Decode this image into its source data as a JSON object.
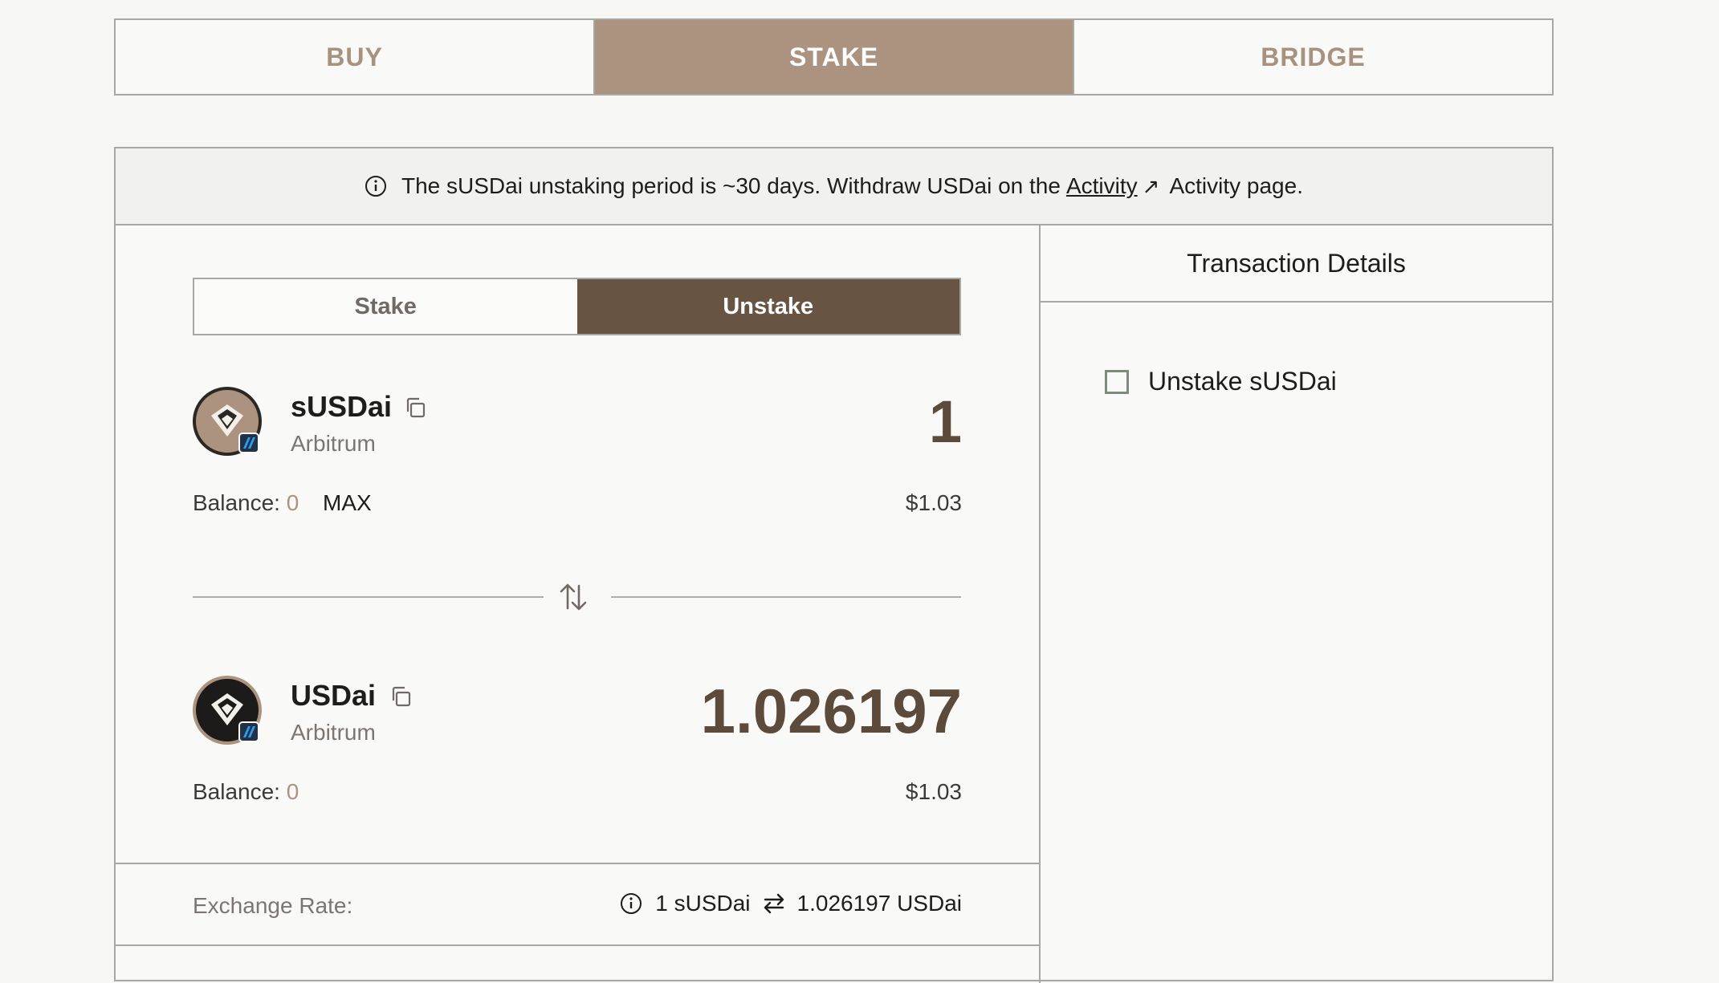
{
  "top_tabs": [
    {
      "label": "BUY",
      "active": false
    },
    {
      "label": "STAKE",
      "active": true
    },
    {
      "label": "BRIDGE",
      "active": false
    }
  ],
  "notice": {
    "text_before": "The sUSDai unstaking period is ~30 days. Withdraw USDai on the",
    "link": "Activity",
    "text_after": "Activity page."
  },
  "mode_toggle": {
    "stake_label": "Stake",
    "unstake_label": "Unstake",
    "active": "Unstake"
  },
  "from_token": {
    "name": "sUSDai",
    "chain": "Arbitrum",
    "amount": "1",
    "balance_label": "Balance:",
    "balance_value": "0",
    "max_label": "MAX",
    "usd_value": "$1.03"
  },
  "to_token": {
    "name": "USDai",
    "chain": "Arbitrum",
    "amount": "1.026197",
    "balance_label": "Balance:",
    "balance_value": "0",
    "usd_value": "$1.03"
  },
  "exchange_rate": {
    "label": "Exchange Rate:",
    "from": "1 sUSDai",
    "to": "1.026197 USDai"
  },
  "transaction_details": {
    "title": "Transaction Details",
    "steps": [
      {
        "label": "Unstake sUSDai",
        "checked": false
      }
    ]
  },
  "colors": {
    "accent": "#ab937f",
    "active_toggle": "#685443",
    "amount": "#5c4a3b",
    "border": "#a8a7a3"
  }
}
